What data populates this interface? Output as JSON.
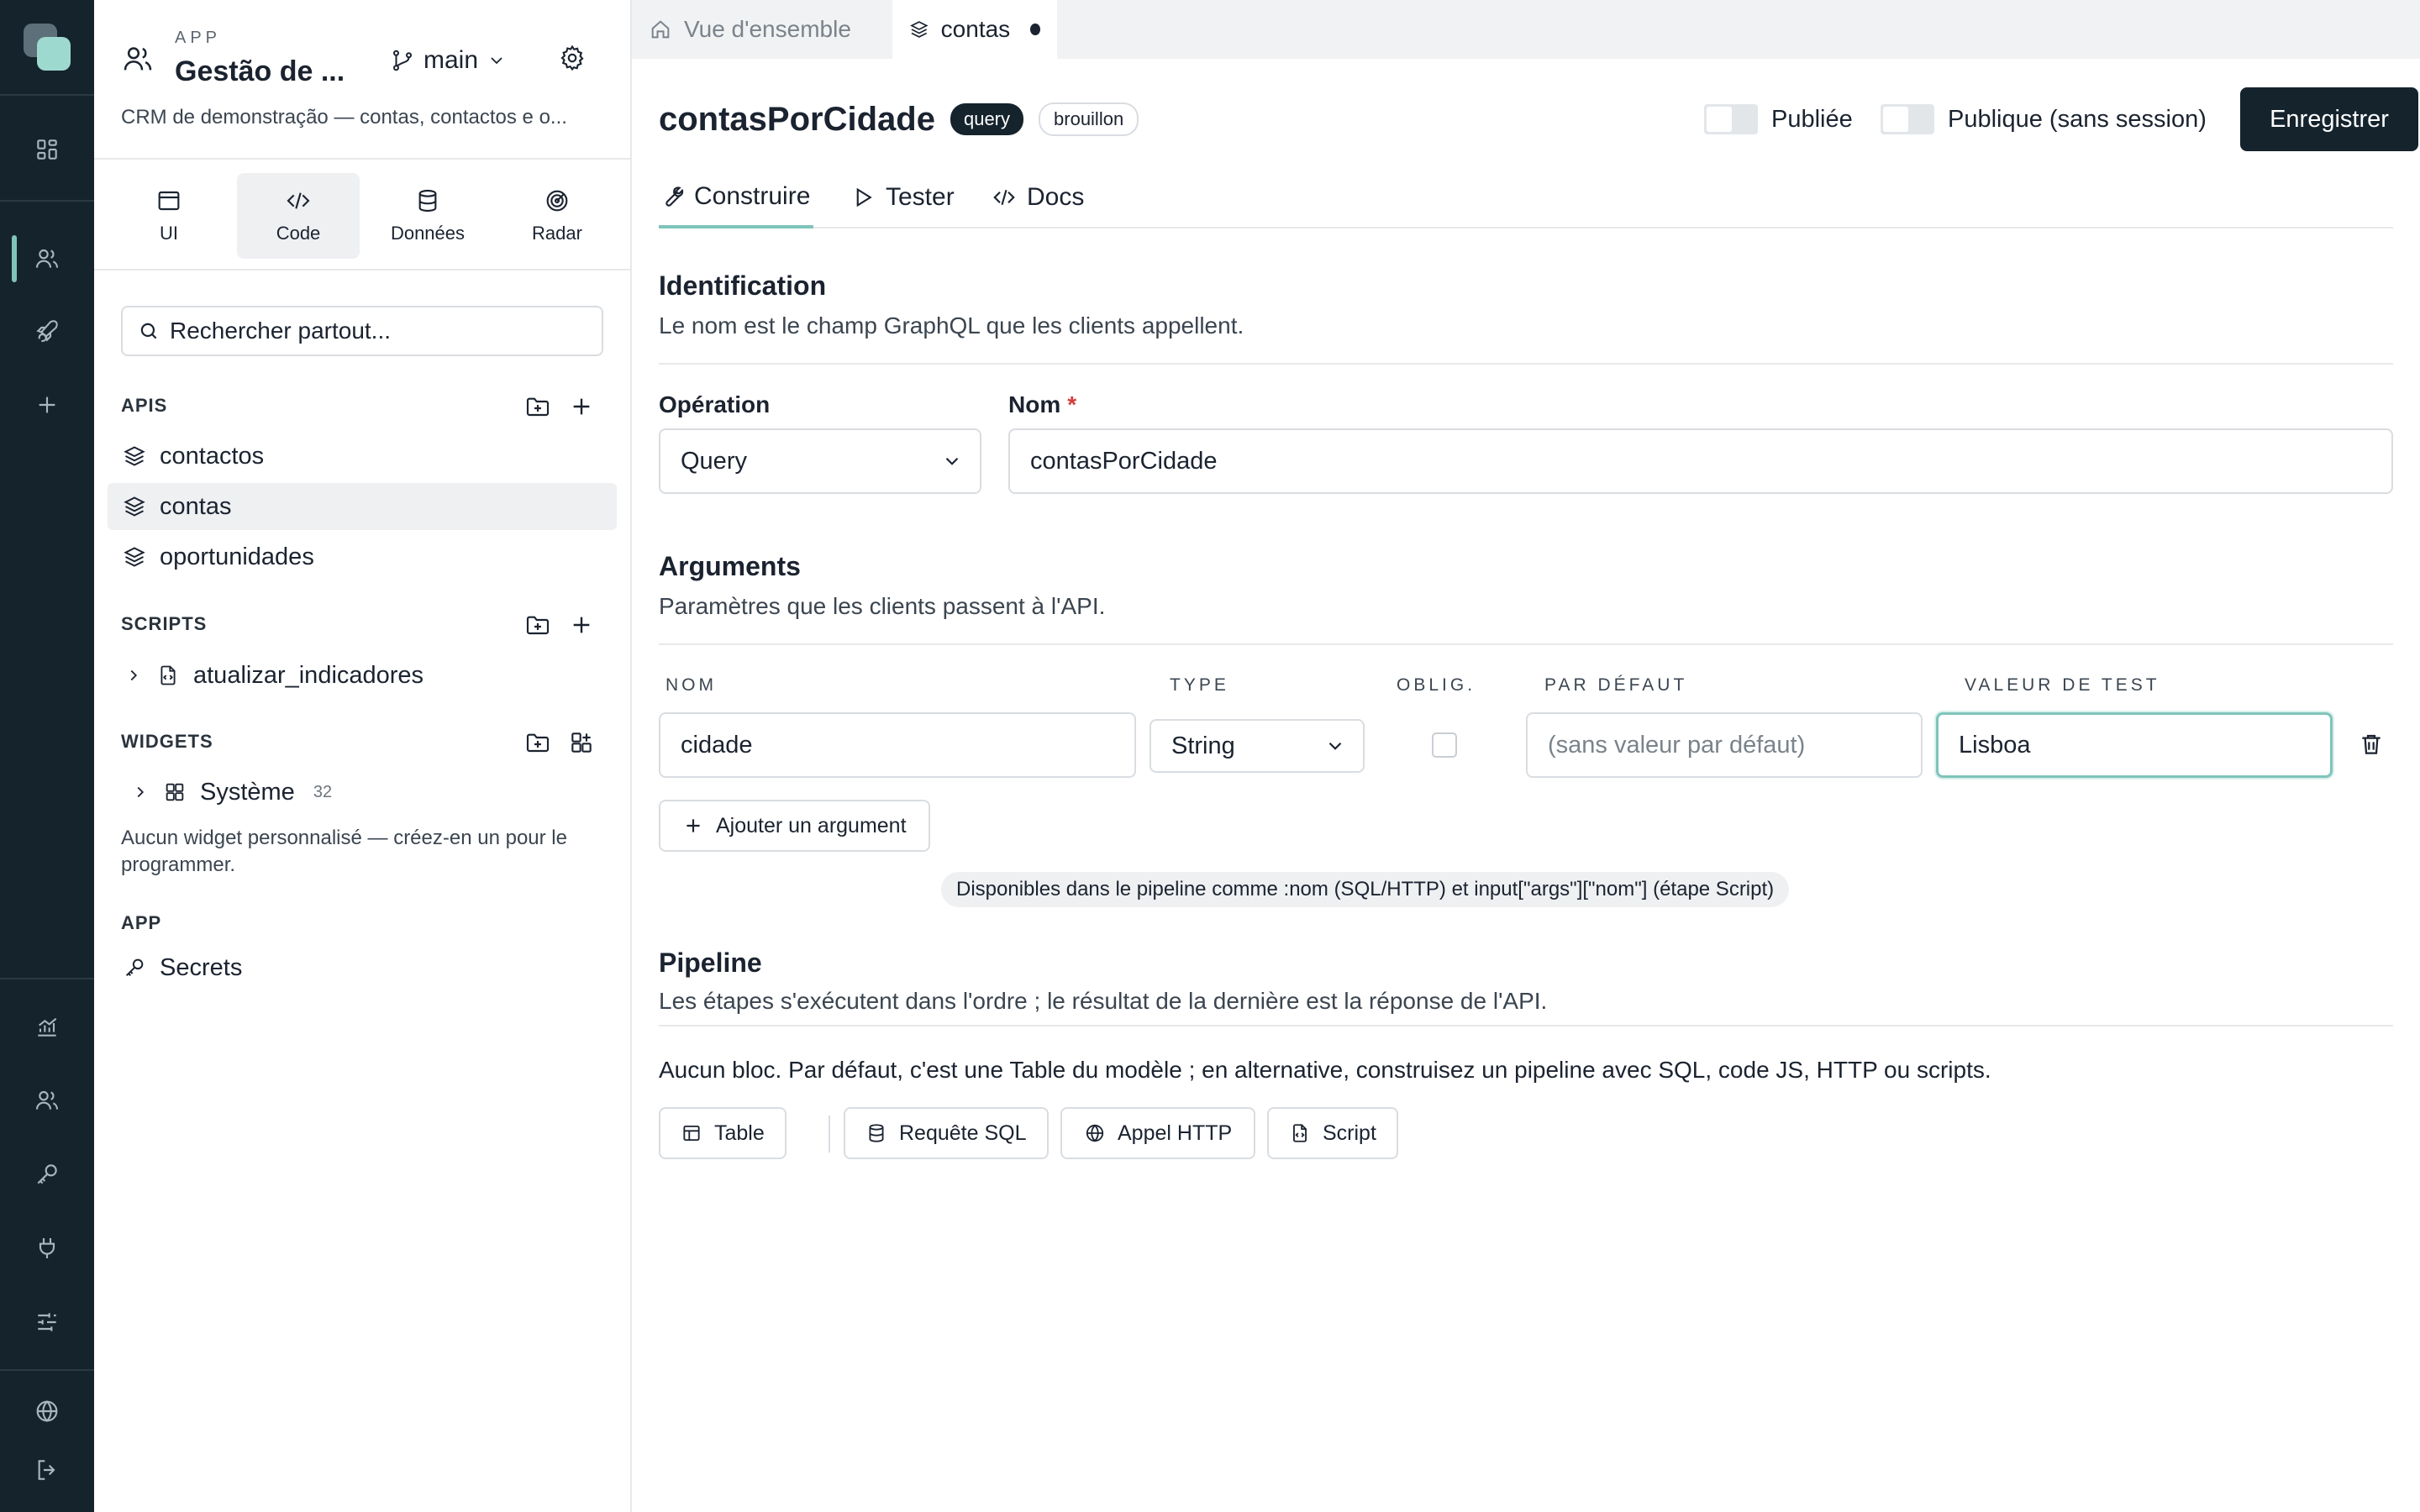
{
  "sidebar": {
    "app_kicker": "APP",
    "app_name": "Gestão de ...",
    "branch": "main",
    "app_desc": "CRM de demonstração — contas, contactos e o...",
    "modes": [
      {
        "label": "UI",
        "icon": "window-icon"
      },
      {
        "label": "Code",
        "icon": "code-icon"
      },
      {
        "label": "Données",
        "icon": "database-icon"
      },
      {
        "label": "Radar",
        "icon": "radar-icon"
      }
    ],
    "search_placeholder": "Rechercher partout...",
    "apis": {
      "title": "APIS",
      "items": [
        {
          "label": "contactos"
        },
        {
          "label": "contas"
        },
        {
          "label": "oportunidades"
        }
      ]
    },
    "scripts": {
      "title": "SCRIPTS",
      "items": [
        {
          "label": "atualizar_indicadores"
        }
      ]
    },
    "widgets": {
      "title": "WIDGETS",
      "items": [
        {
          "label": "Système",
          "count": "32"
        }
      ],
      "note": "Aucun widget personnalisé — créez-en un pour le programmer."
    },
    "app_section": {
      "title": "APP",
      "items": [
        {
          "label": "Secrets"
        }
      ]
    }
  },
  "tabs": [
    {
      "label": "Vue d'ensemble",
      "active": false
    },
    {
      "label": "contas",
      "active": true,
      "dirty": true
    }
  ],
  "editor": {
    "title": "contasPorCidade",
    "badge_kind": "query",
    "badge_status": "brouillon",
    "toggle_published": "Publiée",
    "toggle_public": "Publique (sans session)",
    "save_label": "Enregistrer",
    "subtabs": [
      {
        "label": "Construire",
        "active": true
      },
      {
        "label": "Tester",
        "active": false
      },
      {
        "label": "Docs",
        "active": false
      }
    ],
    "identification": {
      "title": "Identification",
      "desc": "Le nom est le champ GraphQL que les clients appellent.",
      "operation_label": "Opération",
      "operation_value": "Query",
      "name_label": "Nom",
      "required_mark": "*",
      "name_value": "contasPorCidade"
    },
    "arguments": {
      "title": "Arguments",
      "desc": "Paramètres que les clients passent à l'API.",
      "columns": [
        "NOM",
        "TYPE",
        "OBLIG.",
        "PAR DÉFAUT",
        "VALEUR DE TEST"
      ],
      "rows": [
        {
          "name": "cidade",
          "type": "String",
          "required": false,
          "default_placeholder": "(sans valeur par défaut)",
          "test_value": "Lisboa"
        }
      ],
      "add_label": "Ajouter un argument",
      "hint": "Disponibles dans le pipeline comme :nom (SQL/HTTP) et input[\"args\"][\"nom\"] (étape Script)"
    },
    "pipeline": {
      "title": "Pipeline",
      "desc": "Les étapes s'exécutent dans l'ordre ; le résultat de la dernière est la réponse de l'API.",
      "empty_note": "Aucun bloc. Par défaut, c'est une Table du modèle ; en alternative, construisez un pipeline avec SQL, code JS, HTTP ou scripts.",
      "blocks": [
        {
          "label": "Table",
          "icon": "table-icon"
        },
        {
          "label": "Requête SQL",
          "icon": "database-icon"
        },
        {
          "label": "Appel HTTP",
          "icon": "globe-icon"
        },
        {
          "label": "Script",
          "icon": "script-icon"
        }
      ]
    }
  },
  "colors": {
    "rail_bg": "#15232d",
    "accent": "#7fc4ba",
    "primary_button": "#15232d",
    "required": "#d63b3b"
  }
}
